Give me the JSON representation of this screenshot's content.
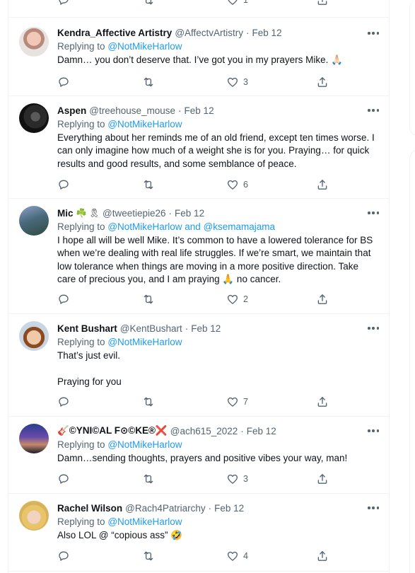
{
  "top": {
    "like_count": "1"
  },
  "tweets": [
    {
      "name": "Kendra_Affective Artistry",
      "name_emoji": "",
      "handle": "@AffectvArtistry",
      "date": "Feb 12",
      "replying_label": "Replying to",
      "replying_to": "@NotMikeHarlow",
      "text": "Damn… you don’t deserve that. I’ve got you in my prayers Mike. 🙏🏻",
      "likes": "3"
    },
    {
      "name": "Aspen",
      "name_emoji": "",
      "handle": "@treehouse_mouse",
      "date": "Feb 12",
      "replying_label": "Replying to",
      "replying_to": "@NotMikeHarlow",
      "text": "Everything about her reminds me of an old friend, except ten times worse. I can only imagine how much of a weight she is for you. Praying… for quick results and good results, and some semblance of peace.",
      "likes": "6"
    },
    {
      "name": "Mic",
      "name_emoji": "☘️ 🎗",
      "handle": "@tweetiepie26",
      "date": "Feb 12",
      "replying_label": "Replying to",
      "replying_to": "@NotMikeHarlow and @ksemamajama",
      "text": "I hope all will be well Mike. It’s common to have a lowered tolerance for BS when we’re dealing with real life struggles. If we’re smart, we maintain that low tolerance when things are moving in a more positive direction. Take care of precious you, and I am praying 🙏 no cancer.",
      "likes": "2"
    },
    {
      "name": "Kent Bushart",
      "name_emoji": "",
      "handle": "@KentBushart",
      "date": "Feb 12",
      "replying_label": "Replying to",
      "replying_to": "@NotMikeHarlow",
      "text": "That’s just evil.\n\nPraying for you",
      "likes": "7"
    },
    {
      "name": "🎸©YNI©AL F⊙©KE®❌",
      "name_emoji": "",
      "handle": "@ach615_2022",
      "date": "Feb 12",
      "replying_label": "Replying to",
      "replying_to": "@NotMikeHarlow",
      "text": "Damn…sending thoughts, prayers and positive vibes your way, man!",
      "likes": "3"
    },
    {
      "name": "Rachel Wilson",
      "name_emoji": "",
      "handle": "@Rach4Patriarchy",
      "date": "Feb 12",
      "replying_label": "Replying to",
      "replying_to": "@NotMikeHarlow",
      "text": "Also LOL @ “copious ass” 🤣",
      "likes": "4"
    }
  ],
  "icons": [
    "reply-icon",
    "retweet-icon",
    "like-icon",
    "share-icon",
    "more-icon"
  ],
  "colors": {
    "link": "#1d9bf0",
    "secondary": "#536471",
    "border": "#eff3f4"
  }
}
